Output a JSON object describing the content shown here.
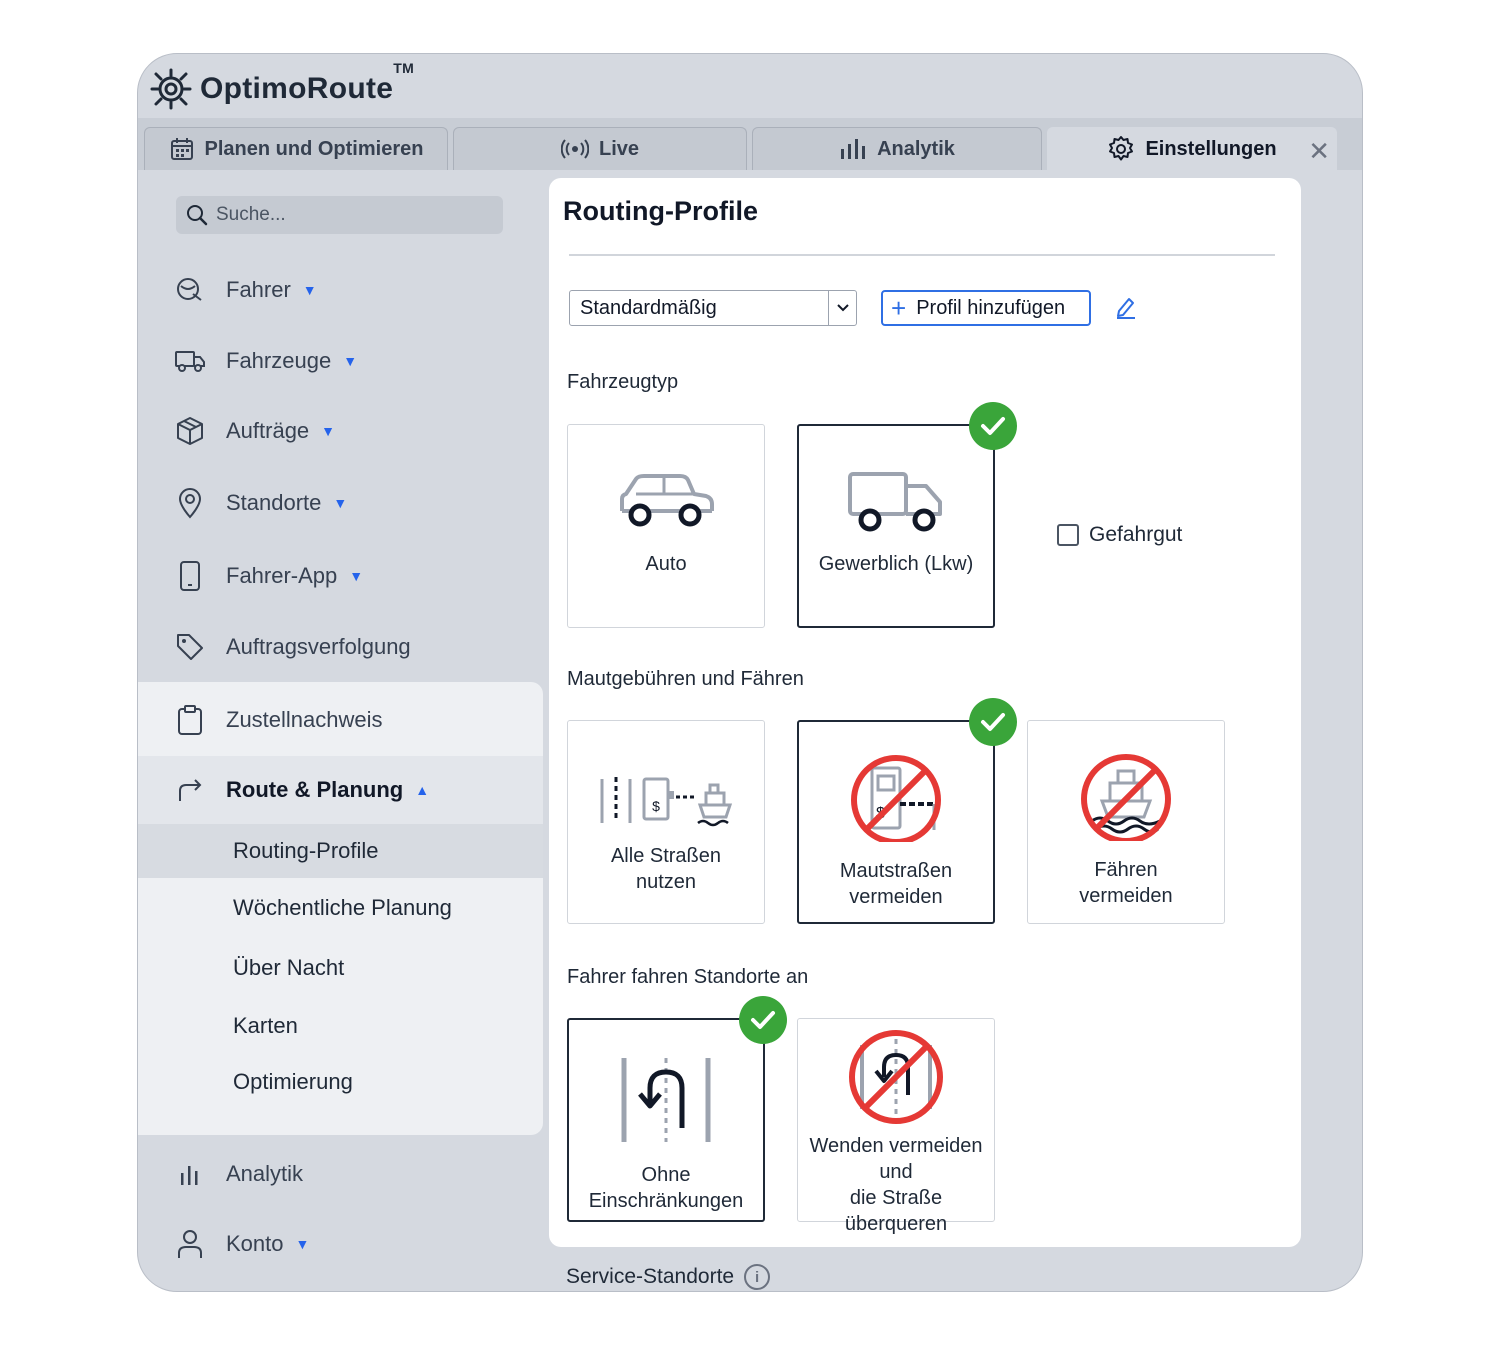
{
  "app": {
    "name": "OptimoRoute",
    "trademark": "TM"
  },
  "tabs": [
    {
      "label": "Planen und Optimieren",
      "icon": "calendar-icon"
    },
    {
      "label": "Live",
      "icon": "broadcast-icon"
    },
    {
      "label": "Analytik",
      "icon": "bar-chart-icon"
    },
    {
      "label": "Einstellungen",
      "icon": "gear-icon",
      "active": true
    }
  ],
  "tab_close": "✕",
  "search": {
    "placeholder": "Suche..."
  },
  "sidebar": {
    "items": [
      {
        "label": "Fahrer",
        "icon": "driver-icon",
        "caret": "▼"
      },
      {
        "label": "Fahrzeuge",
        "icon": "truck-icon",
        "caret": "▼"
      },
      {
        "label": "Aufträge",
        "icon": "box-icon",
        "caret": "▼"
      },
      {
        "label": "Standorte",
        "icon": "location-pin-icon",
        "caret": "▼"
      },
      {
        "label": "Fahrer-App",
        "icon": "phone-icon",
        "caret": "▼"
      },
      {
        "label": "Auftragsverfolgung",
        "icon": "tag-icon"
      },
      {
        "label": "Zustellnachweis",
        "icon": "clipboard-icon"
      },
      {
        "label": "Route & Planung",
        "icon": "route-arrow-icon",
        "caret": "▲"
      },
      {
        "label": "Analytik",
        "icon": "bar-chart-icon"
      },
      {
        "label": "Konto",
        "icon": "user-icon",
        "caret": "▼"
      }
    ],
    "subitems": [
      "Routing-Profile",
      "Wöchentliche Planung",
      "Über Nacht",
      "Karten",
      "Optimierung"
    ],
    "active_subitem": "Routing-Profile"
  },
  "main": {
    "title": "Routing-Profile",
    "profile_select": {
      "value": "Standardmäßig"
    },
    "add_profile_label": "Profil hinzufügen",
    "sections": {
      "vehicle_type": {
        "label": "Fahrzeugtyp",
        "options": [
          {
            "label": "Auto",
            "icon": "car-icon",
            "selected": false
          },
          {
            "label": "Gewerblich (Lkw)",
            "icon": "truck-icon",
            "selected": true
          }
        ],
        "hazmat_label": "Gefahrgut",
        "hazmat_checked": false
      },
      "tolls_ferries": {
        "label": "Mautgebühren und Fähren",
        "options": [
          {
            "label_line1": "Alle Straßen",
            "label_line2": "nutzen",
            "icon": "all-roads-icon",
            "selected": false
          },
          {
            "label_line1": "Mautstraßen",
            "label_line2": "vermeiden",
            "icon": "no-toll-icon",
            "selected": true
          },
          {
            "label_line1": "Fähren",
            "label_line2": "vermeiden",
            "icon": "no-ferry-icon",
            "selected": false
          }
        ]
      },
      "approach": {
        "label": "Fahrer fahren Standorte an",
        "options": [
          {
            "label_line1": "Ohne Einschränkungen",
            "icon": "u-turn-icon",
            "selected": true
          },
          {
            "label_line1": "Wenden vermeiden und",
            "label_line2": "die Straße überqueren",
            "icon": "no-u-turn-icon",
            "selected": false
          }
        ]
      }
    },
    "service_locations_label": "Service-Standorte"
  },
  "colors": {
    "accent": "#2f6fe4",
    "check": "#3aa53a",
    "forbidden": "#e53935"
  }
}
